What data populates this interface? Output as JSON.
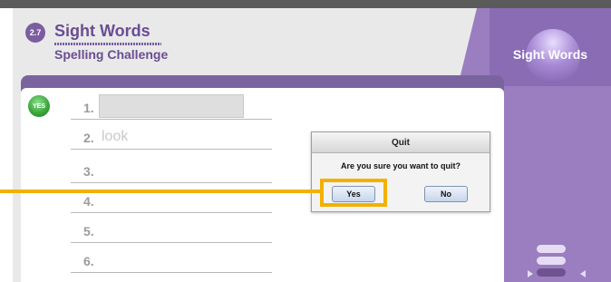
{
  "lesson": {
    "number": "2.7",
    "title": "Sight Words",
    "subtitle": "Spelling Challenge"
  },
  "sidebar": {
    "title": "Sight Words"
  },
  "status_badge": {
    "label": "YES"
  },
  "words": [
    {
      "num": "1.",
      "text": ""
    },
    {
      "num": "2.",
      "text": "look"
    },
    {
      "num": "3.",
      "text": ""
    },
    {
      "num": "4.",
      "text": ""
    },
    {
      "num": "5.",
      "text": ""
    },
    {
      "num": "6.",
      "text": ""
    }
  ],
  "dialog": {
    "title": "Quit",
    "message": "Are you sure you want to quit?",
    "yes_label": "Yes",
    "no_label": "No"
  },
  "colors": {
    "accent": "#9a7ec0",
    "highlight": "#f2b100",
    "yes_badge": "#3da83d"
  }
}
